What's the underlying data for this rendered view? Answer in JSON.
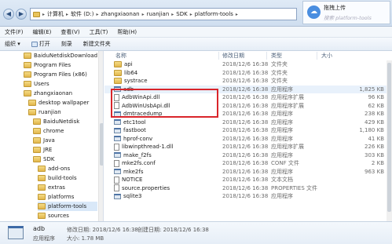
{
  "address_bar": {
    "breadcrumbs": [
      "计算机",
      "软件 (D:)",
      "zhangxiaonan",
      "ruanjian",
      "SDK",
      "platform-tools"
    ]
  },
  "baidu_panel": {
    "label": "拖拽上传",
    "search_placeholder": "搜索 platform-tools"
  },
  "menu": [
    "文件(F)",
    "编辑(E)",
    "查看(V)",
    "工具(T)",
    "帮助(H)"
  ],
  "toolbar": {
    "organize": "组织 ▾",
    "open": "打开",
    "burn": "刻录",
    "new_folder": "新建文件夹"
  },
  "nav_tree": [
    {
      "label": "BaiduNetdiskDownload"
    },
    {
      "label": "Program Files"
    },
    {
      "label": "Program Files (x86)"
    },
    {
      "label": "Users"
    },
    {
      "label": "zhangxiaonan"
    },
    {
      "label": "desktop wallpaper"
    },
    {
      "label": "ruanjian"
    },
    {
      "label": "BaiduNetdisk"
    },
    {
      "label": "chrome"
    },
    {
      "label": "Java"
    },
    {
      "label": "JRE"
    },
    {
      "label": "SDK"
    },
    {
      "label": "add-ons"
    },
    {
      "label": "build-tools"
    },
    {
      "label": "extras"
    },
    {
      "label": "platforms"
    },
    {
      "label": "platform-tools"
    },
    {
      "label": "sources"
    }
  ],
  "columns": {
    "name": "名称",
    "date": "修改日期",
    "type": "类型",
    "size": "大小"
  },
  "files": [
    {
      "name": "api",
      "date": "2018/12/6 16:38",
      "type": "文件夹",
      "size": "",
      "icon": "folder"
    },
    {
      "name": "lib64",
      "date": "2018/12/6 16:38",
      "type": "文件夹",
      "size": "",
      "icon": "folder"
    },
    {
      "name": "systrace",
      "date": "2018/12/6 16:38",
      "type": "文件夹",
      "size": "",
      "icon": "folder"
    },
    {
      "name": "adb",
      "date": "2018/12/6 16:38",
      "type": "应用程序",
      "size": "1,825 KB",
      "icon": "exe"
    },
    {
      "name": "AdbWinApi.dll",
      "date": "2018/12/6 16:38",
      "type": "应用程序扩展",
      "size": "96 KB",
      "icon": "dll"
    },
    {
      "name": "AdbWinUsbApi.dll",
      "date": "2018/12/6 16:38",
      "type": "应用程序扩展",
      "size": "62 KB",
      "icon": "dll"
    },
    {
      "name": "dmtracedump",
      "date": "2018/12/6 16:38",
      "type": "应用程序",
      "size": "238 KB",
      "icon": "exe"
    },
    {
      "name": "etc1tool",
      "date": "2018/12/6 16:38",
      "type": "应用程序",
      "size": "429 KB",
      "icon": "exe"
    },
    {
      "name": "fastboot",
      "date": "2018/12/6 16:38",
      "type": "应用程序",
      "size": "1,180 KB",
      "icon": "exe"
    },
    {
      "name": "hprof-conv",
      "date": "2018/12/6 16:38",
      "type": "应用程序",
      "size": "41 KB",
      "icon": "exe"
    },
    {
      "name": "libwinpthread-1.dll",
      "date": "2018/12/6 16:38",
      "type": "应用程序扩展",
      "size": "226 KB",
      "icon": "dll"
    },
    {
      "name": "make_f2fs",
      "date": "2018/12/6 16:38",
      "type": "应用程序",
      "size": "303 KB",
      "icon": "exe"
    },
    {
      "name": "mke2fs.conf",
      "date": "2018/12/6 16:38",
      "type": "CONF 文件",
      "size": "2 KB",
      "icon": "file"
    },
    {
      "name": "mke2fs",
      "date": "2018/12/6 16:38",
      "type": "应用程序",
      "size": "963 KB",
      "icon": "exe"
    },
    {
      "name": "NOTICE",
      "date": "2018/12/6 16:38",
      "type": "文本文档",
      "size": "",
      "icon": "file"
    },
    {
      "name": "source.properties",
      "date": "2018/12/6 16:38",
      "type": "PROPERTIES 文件",
      "size": "",
      "icon": "file"
    },
    {
      "name": "sqlite3",
      "date": "2018/12/6 16:38",
      "type": "应用程序",
      "size": "",
      "icon": "exe"
    }
  ],
  "details": {
    "name": "adb",
    "modified_label": "修改日期: 2018/12/6 16:38",
    "created_label": "创建日期: 2018/12/6 16:38",
    "type": "应用程序",
    "size_label": "大小: 1.78 MB"
  }
}
